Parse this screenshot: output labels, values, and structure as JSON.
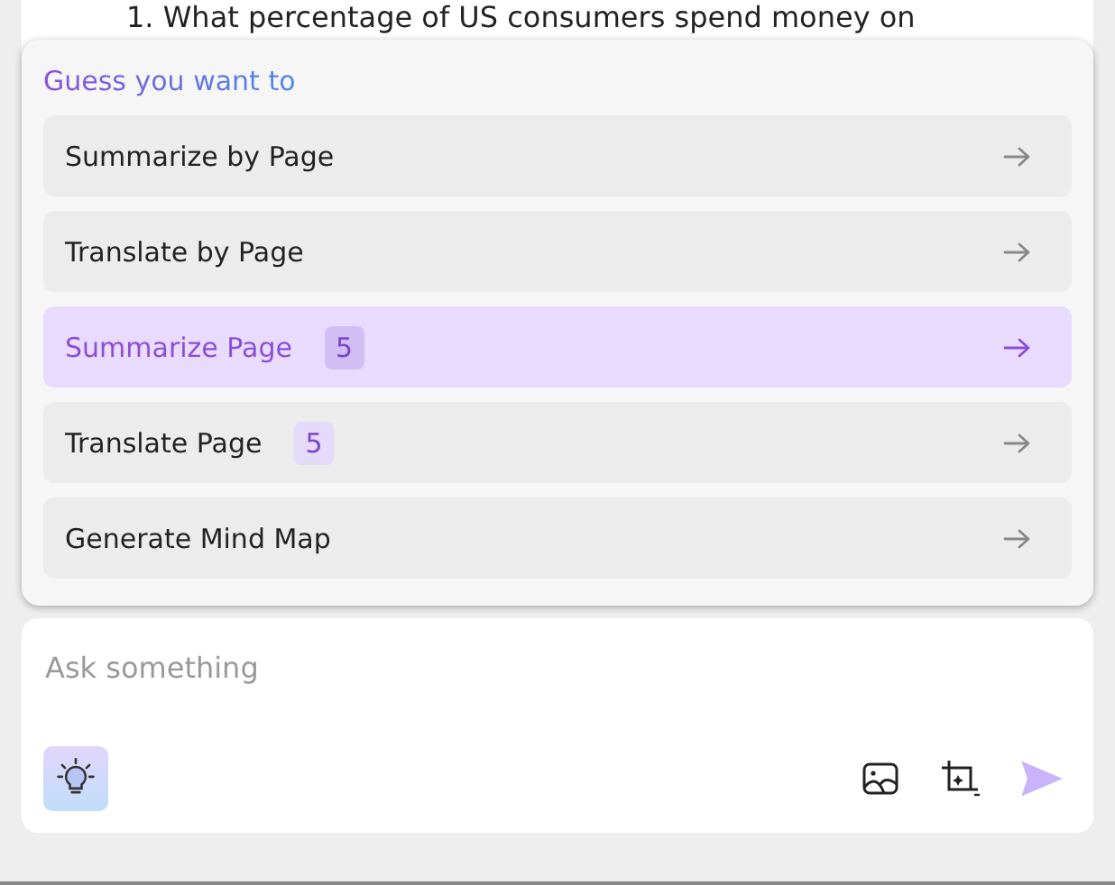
{
  "document": {
    "text": "1. What percentage of US consumers spend money on"
  },
  "suggestions": {
    "title": "Guess you want to",
    "items": [
      {
        "label": "Summarize by Page",
        "selected": false
      },
      {
        "label": "Translate by Page",
        "selected": false
      },
      {
        "label": "Summarize Page",
        "badge": "5",
        "selected": true
      },
      {
        "label": "Translate Page",
        "badge": "5",
        "selected": false
      },
      {
        "label": "Generate Mind Map",
        "selected": false
      }
    ]
  },
  "composer": {
    "placeholder": "Ask something"
  }
}
